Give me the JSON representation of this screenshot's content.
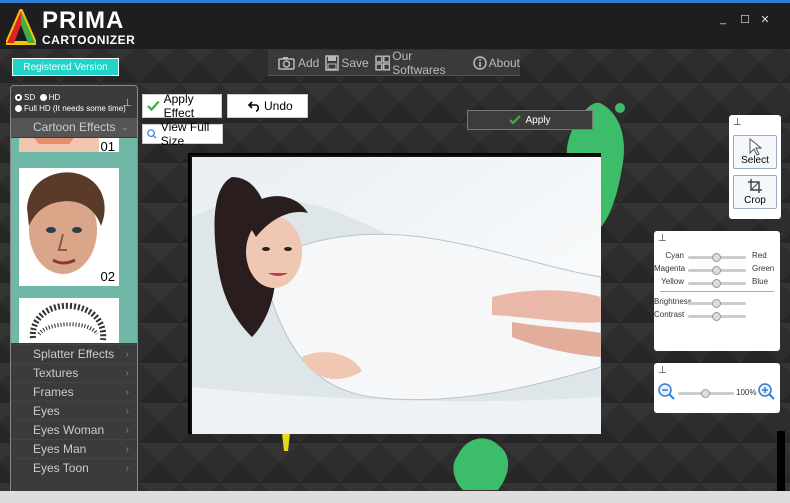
{
  "app": {
    "logo_line1": "PRIMA",
    "logo_line2": "CARTOONIZER",
    "accent": "#2f7fd8",
    "brand_teal": "#1fd4c9"
  },
  "window": {
    "minimize": "_",
    "maximize": "☐",
    "close": "✕"
  },
  "registered_label": "Registered Version",
  "menu": {
    "add": "Add",
    "save": "Save",
    "softwares": "Our Softwares",
    "about": "About"
  },
  "sidebar": {
    "quality_sd": "SD",
    "quality_hd": "HD",
    "quality_fullhd": "Full HD (It needs some time)",
    "selected_quality": "SD",
    "active_category": "Cartoon Effects",
    "thumb_top_number": "01",
    "thumb_number": "02",
    "categories": [
      "Splatter Effects",
      "Textures",
      "Frames",
      "Eyes",
      "Eyes Woman",
      "Eyes Man",
      "Eyes Toon"
    ]
  },
  "toolbar": {
    "apply_effect": "Apply Effect",
    "undo": "Undo",
    "view_full_size": "View Full Size",
    "apply": "Apply"
  },
  "tools": {
    "select": "Select",
    "crop": "Crop"
  },
  "color_adjust": {
    "sliders": [
      {
        "left": "Cyan",
        "right": "Red",
        "value": 0.5
      },
      {
        "left": "Magenta",
        "right": "Green",
        "value": 0.5
      },
      {
        "left": "Yellow",
        "right": "Blue",
        "value": 0.5
      }
    ],
    "brightness_label": "Brightness",
    "brightness_value": 0.5,
    "contrast_label": "Contrast",
    "contrast_value": 0.5
  },
  "zoom": {
    "level": "100%",
    "value": 0.5
  }
}
